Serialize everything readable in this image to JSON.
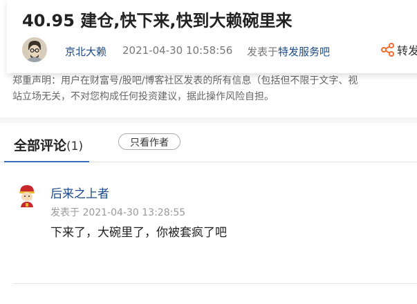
{
  "post": {
    "title": "40.95 建仓,快下来,快到大赖碗里来",
    "author": "京北大赖",
    "time": "2021-04-30 10:58:56",
    "posted_in_prefix": "发表于",
    "posted_in_forum": "特发服务吧",
    "share_label": "转发"
  },
  "disclaimer": {
    "line1": "郑重声明：用户在财富号/股吧/博客社区发表的所有信息（包括但不限于文字、视",
    "line2": "站立场无关，不对您构成任何投资建议，据此操作风险自担。"
  },
  "comments": {
    "tab_label": "全部评论",
    "tab_count": "(1)",
    "author_only_label": "只看作者",
    "items": [
      {
        "user": "后来之上者",
        "time": "发表于 2021-04-30 13:28:55",
        "text": "下来了，大碗里了，你被套疯了吧"
      }
    ]
  },
  "colors": {
    "link_blue": "#1a4a8a",
    "share_orange": "#f26a2e",
    "tab_underline": "#3b6cb7"
  },
  "icons": {
    "share": "share-icon",
    "author_avatar": "author-avatar",
    "commenter_avatar": "commenter-avatar"
  }
}
